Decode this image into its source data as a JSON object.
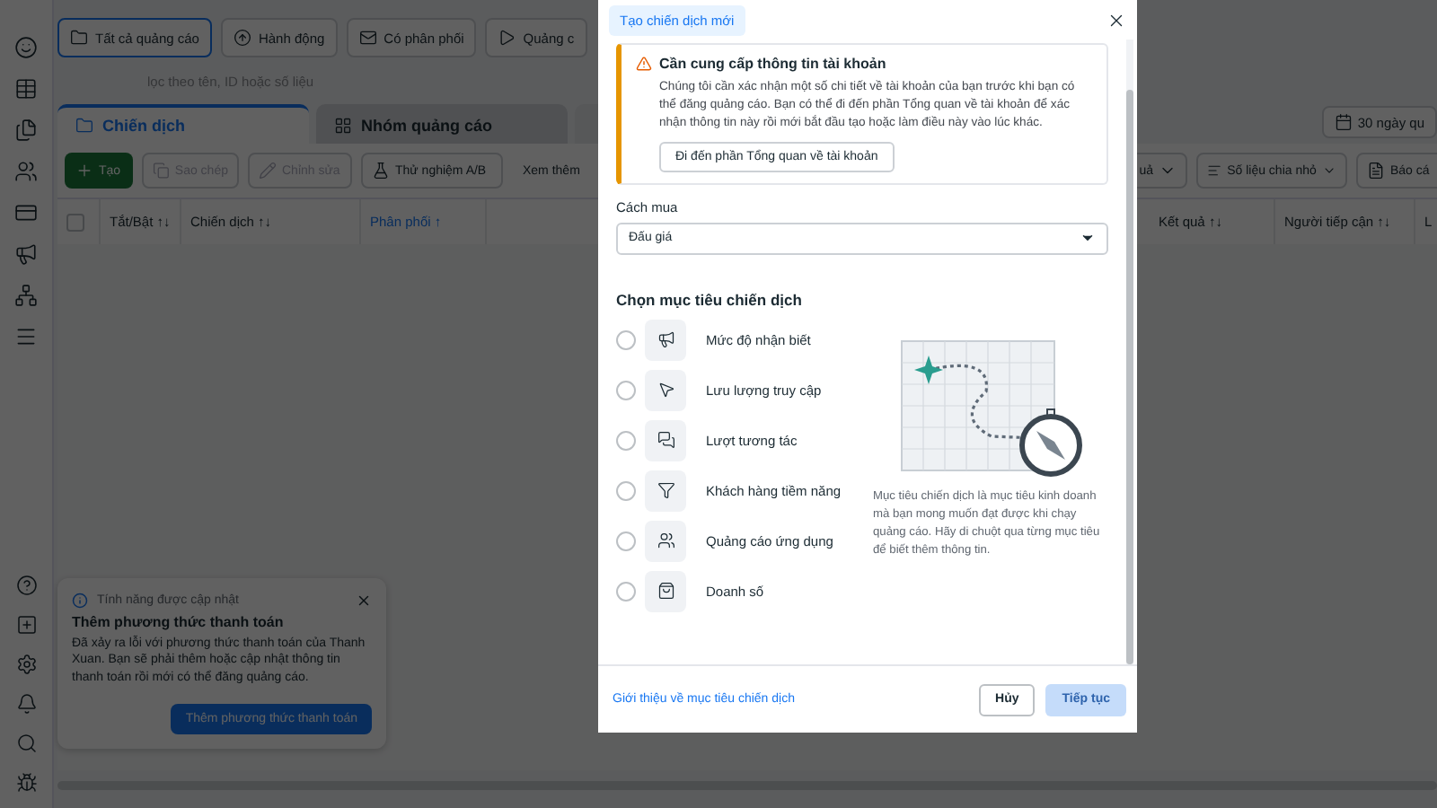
{
  "filter_chips": [
    {
      "label": "Tất cả quảng cáo",
      "selected": true
    },
    {
      "label": "Hành động",
      "selected": false
    },
    {
      "label": "Có phân phối",
      "selected": false
    },
    {
      "label": "Quảng c",
      "selected": false
    }
  ],
  "search": {
    "placeholder": "lọc theo tên, ID hoặc số liệu"
  },
  "level_tabs": [
    {
      "label": "Chiến dịch",
      "selected": true
    },
    {
      "label": "Nhóm quảng cáo",
      "selected": false
    }
  ],
  "date_range": "30 ngày qu",
  "actions": [
    {
      "label": "Tạo",
      "kind": "primary"
    },
    {
      "label": "Sao chép",
      "kind": "disabled"
    },
    {
      "label": "Chỉnh sửa",
      "kind": "disabled"
    },
    {
      "label": "Thử nghiệm A/B",
      "kind": "outline"
    },
    {
      "label": "Xem thêm",
      "kind": "text"
    }
  ],
  "view_controls": [
    "uả",
    "Số liệu chia nhỏ",
    "Báo cá"
  ],
  "table": {
    "select_all": {
      "checked": false
    },
    "columns": [
      {
        "label": "Tắt/Bật ↑↓",
        "sorted": false
      },
      {
        "label": "Chiến dịch ↑↓",
        "sorted": false
      },
      {
        "label": "Phân phối ↑",
        "sorted": true
      },
      {
        "label": "Kết quả ↑↓",
        "sorted": false
      },
      {
        "label": "Người tiếp cận ↑↓",
        "sorted": false
      },
      {
        "label": "L",
        "sorted": false
      }
    ]
  },
  "notice": {
    "tag": "Tính năng được cập nhật",
    "title": "Thêm phương thức thanh toán",
    "body": "Đã xảy ra lỗi với phương thức thanh toán của Thanh Xuan. Bạn sẽ phải thêm hoặc cập nhật thông tin thanh toán rồi mới có thể đăng quảng cáo.",
    "button": "Thêm phương thức thanh toán"
  },
  "dialog": {
    "title": "Tạo chiến dịch mới",
    "alert": {
      "title": "Cần cung cấp thông tin tài khoản",
      "body": "Chúng tôi cần xác nhận một số chi tiết về tài khoản của bạn trước khi bạn có thể đăng quảng cáo. Bạn có thể đi đến phần Tổng quan về tài khoản để xác nhận thông tin này rồi mới bắt đầu tạo hoặc làm điều này vào lúc khác.",
      "button": "Đi đến phần Tổng quan về tài khoản"
    },
    "buying": {
      "label": "Cách mua",
      "value": "Đấu giá"
    },
    "objectives_title": "Chọn mục tiêu chiến dịch",
    "objectives": [
      {
        "label": "Mức độ nhận biết",
        "selected": false
      },
      {
        "label": "Lưu lượng truy cập",
        "selected": false
      },
      {
        "label": "Lượt tương tác",
        "selected": false
      },
      {
        "label": "Khách hàng tiềm năng",
        "selected": false
      },
      {
        "label": "Quảng cáo ứng dụng",
        "selected": false
      },
      {
        "label": "Doanh số",
        "selected": false
      }
    ],
    "help": "Mục tiêu chiến dịch là mục tiêu kinh doanh mà bạn mong muốn đạt được khi chạy quảng cáo. Hãy di chuột qua từng mục tiêu để biết thêm thông tin.",
    "footer_link": "Giới thiệu về mục tiêu chiến dịch",
    "cancel": "Hủy",
    "continue": {
      "label": "Tiếp tục",
      "disabled": true
    }
  }
}
